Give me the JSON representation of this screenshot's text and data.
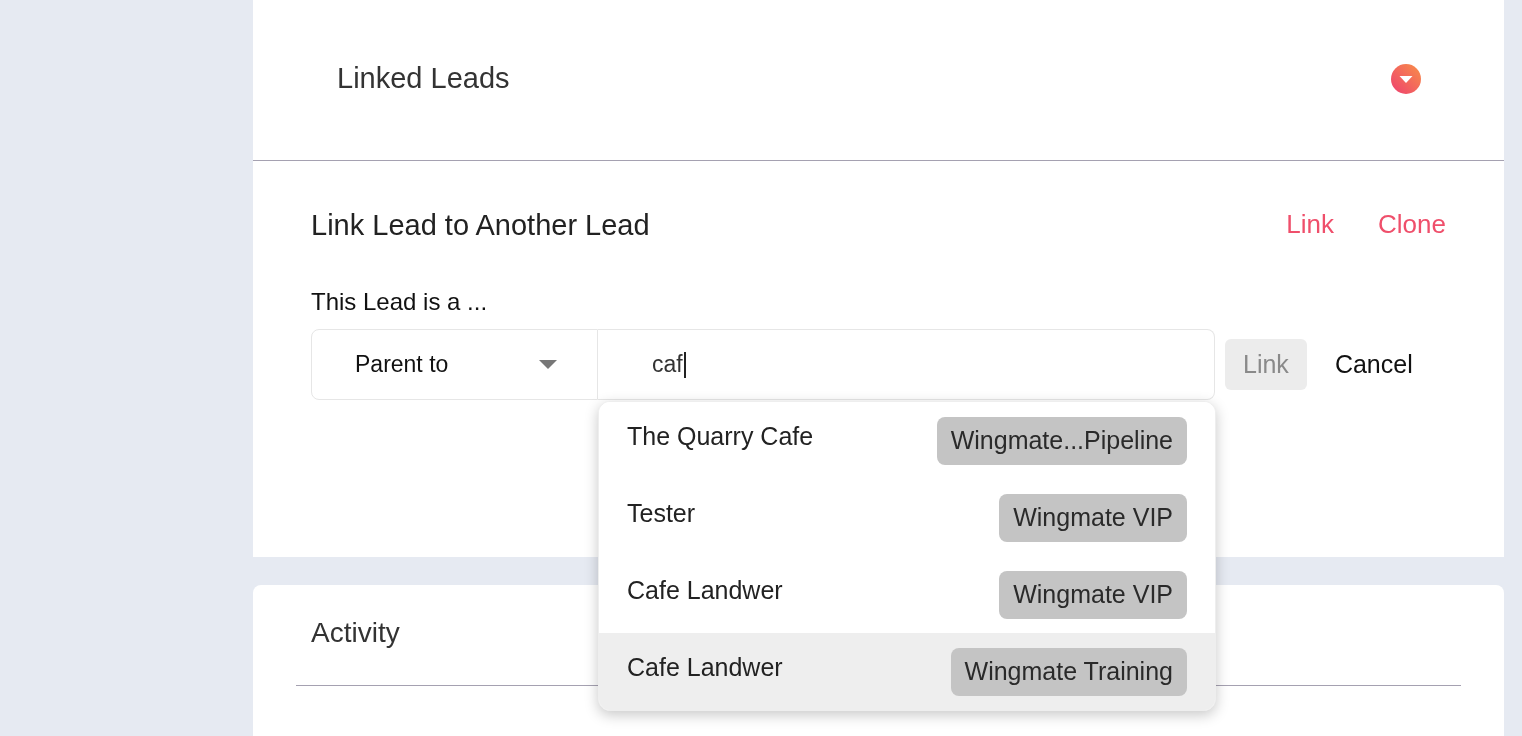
{
  "panel": {
    "title": "Linked Leads"
  },
  "link_section": {
    "title": "Link Lead to Another Lead",
    "actions": [
      "Link",
      "Clone"
    ],
    "relation_label": "This Lead is a ...",
    "relation_select": {
      "value": "Parent to"
    },
    "search_field": {
      "value": "caf"
    },
    "buttons": [
      {
        "label": "Link",
        "kind": "primary",
        "disabled": true
      },
      {
        "label": "Cancel",
        "kind": "plain",
        "disabled": false
      }
    ],
    "results": [
      {
        "name": "The Quarry Cafe",
        "tag": "Wingmate...Pipeline",
        "selected": false
      },
      {
        "name": "Tester",
        "tag": "Wingmate VIP",
        "selected": false
      },
      {
        "name": "Cafe Landwer",
        "tag": "Wingmate VIP",
        "selected": false
      },
      {
        "name": "Cafe Landwer",
        "tag": "Wingmate Training",
        "selected": true
      }
    ]
  },
  "activity": {
    "title": "Activity"
  }
}
